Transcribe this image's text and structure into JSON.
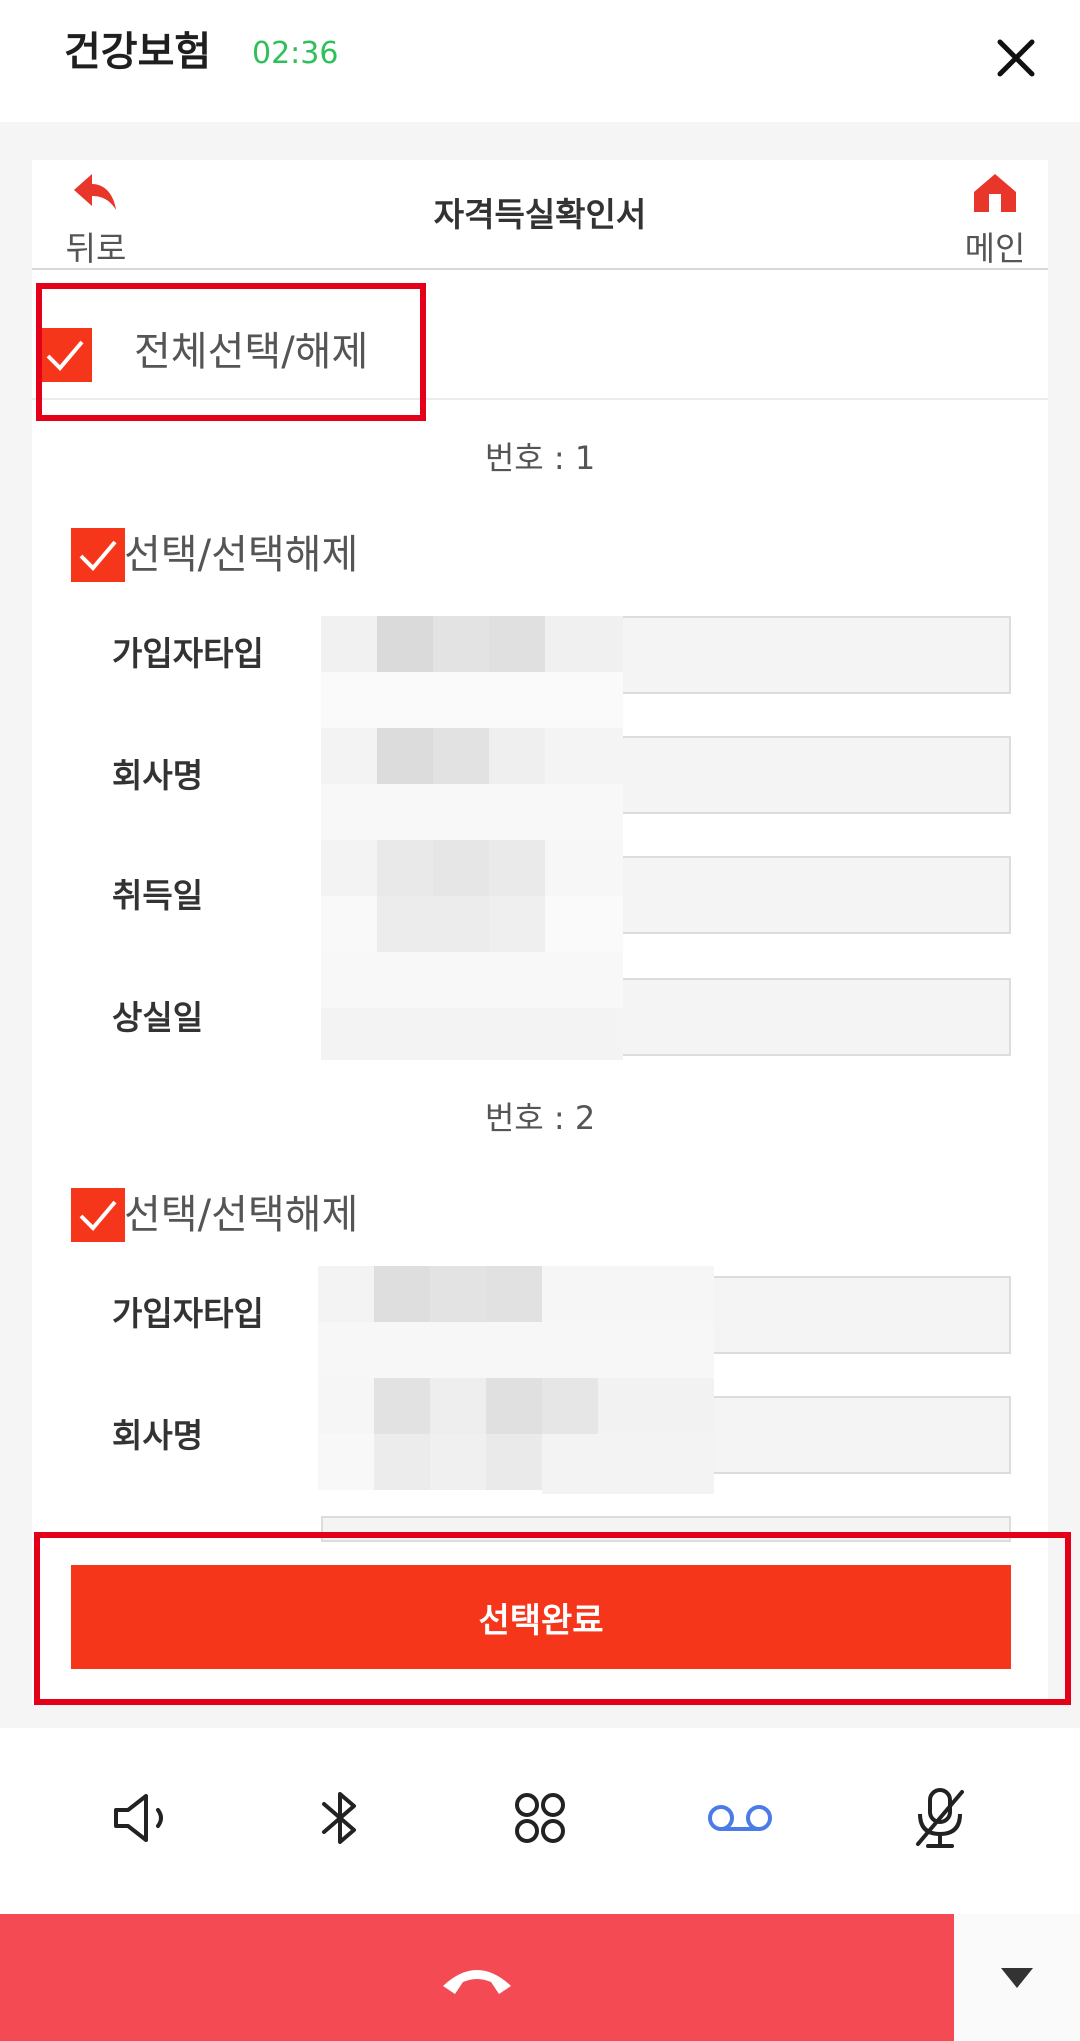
{
  "call": {
    "app_title": "건강보험",
    "timer": "02:36"
  },
  "doc": {
    "back_label": "뒤로",
    "title": "자격득실확인서",
    "home_label": "메인"
  },
  "select_all": {
    "label": "전체선택/해제",
    "checked": true
  },
  "records": [
    {
      "number_label": "번호 : 1",
      "toggle_label": "선택/선택해제",
      "checked": true,
      "fields": [
        {
          "label": "가입자타입"
        },
        {
          "label": "회사명"
        },
        {
          "label": "취득일"
        },
        {
          "label": "상실일"
        }
      ]
    },
    {
      "number_label": "번호 : 2",
      "toggle_label": "선택/선택해제",
      "checked": true,
      "fields": [
        {
          "label": "가입자타입"
        },
        {
          "label": "회사명"
        }
      ]
    }
  ],
  "submit": {
    "label": "선택완료"
  },
  "controls": {
    "icons": [
      "speaker-icon",
      "bluetooth-icon",
      "keypad-icon",
      "voicemail-icon",
      "mute-mic-icon"
    ],
    "active": "voicemail-icon"
  },
  "colors": {
    "accent": "#f5361a",
    "timer": "#2fbf5b",
    "end_call": "#f44a54",
    "highlight": "#e5001a",
    "active_icon": "#4a7be8"
  }
}
